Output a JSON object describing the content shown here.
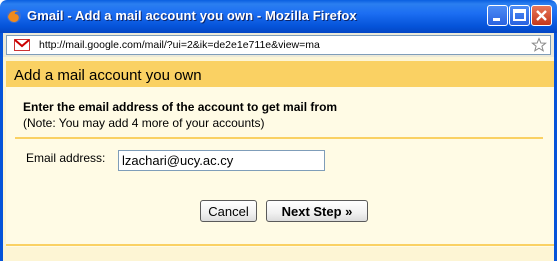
{
  "window": {
    "title": "Gmail - Add a mail account you own - Mozilla Firefox",
    "url": "http://mail.google.com/mail/?ui=2&ik=de2e1e711e&view=ma"
  },
  "form": {
    "heading": "Add a mail account you own",
    "instruction": "Enter the email address of the account to get mail from",
    "note": "(Note: You may add 4 more of your accounts)",
    "email_label": "Email address:",
    "email_value": "lzachari@ucy.ac.cy",
    "cancel_label": "Cancel",
    "next_label": "Next Step »"
  },
  "icons": {
    "app": "firefox-icon",
    "favicon": "gmail-icon",
    "bookmark": "star-icon",
    "minimize": "minimize-icon",
    "maximize": "maximize-icon",
    "close": "close-icon"
  },
  "colors": {
    "titlebar": "#0553d9",
    "header_band": "#fad163",
    "panel_bg": "#fffbe5",
    "close_button": "#c4371b"
  }
}
